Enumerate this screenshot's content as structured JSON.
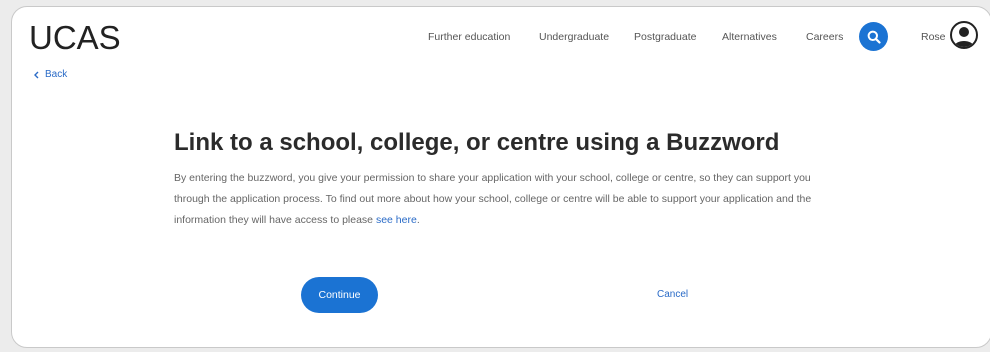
{
  "header": {
    "logo": "UCAS",
    "nav": [
      "Further education",
      "Undergraduate",
      "Postgraduate",
      "Alternatives",
      "Careers"
    ],
    "user_name": "Rose",
    "icons": {
      "search": "search-icon",
      "avatar": "user-avatar-icon",
      "back": "chevron-left-icon"
    }
  },
  "back_label": "Back",
  "page": {
    "title": "Link to a school, college, or centre using a Buzzword",
    "body_before_link": "By entering the buzzword, you give your permission to share your application with your school, college or centre, so they can support you through the application process. To find out more about how your school, college or centre will be able to support your application and the information they will have access to please ",
    "link_text": "see here",
    "body_after_link": "."
  },
  "actions": {
    "continue_label": "Continue",
    "cancel_label": "Cancel"
  },
  "colors": {
    "accent": "#1b73d3",
    "link": "#2a6bc7",
    "title": "#2b2b2b"
  }
}
